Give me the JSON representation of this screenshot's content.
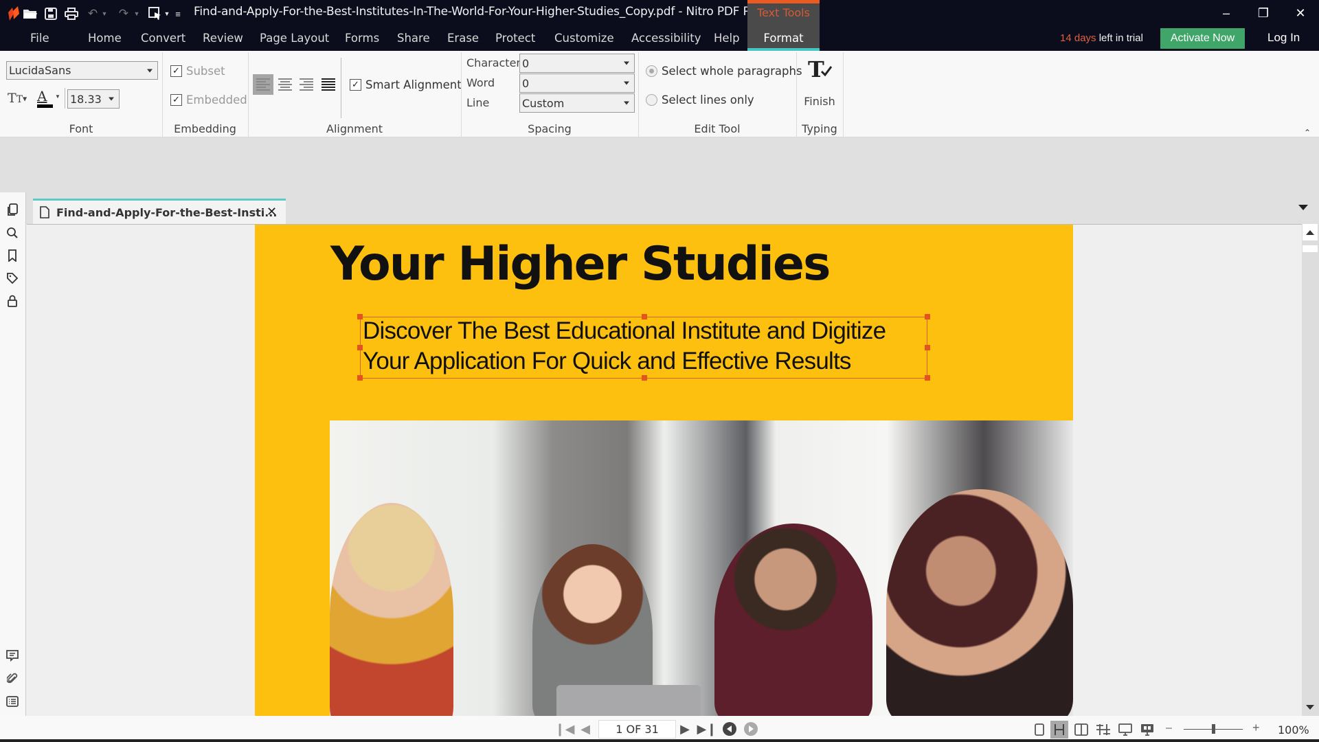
{
  "app": {
    "window_title": "Find-and-Apply-For-the-Best-Institutes-In-The-World-For-Your-Higher-Studies_Copy.pdf - Nitro PDF Pro",
    "quick_access": [
      "nitro-logo",
      "open-folder-icon",
      "save-icon",
      "print-icon",
      "undo-icon",
      "redo-icon",
      "select-icon",
      "customize-qat-icon"
    ],
    "contextual_tab_group": "Text Tools",
    "window_controls": {
      "minimize": "–",
      "restore": "❐",
      "close": "✕"
    }
  },
  "menu": {
    "items": [
      "File",
      "Home",
      "Convert",
      "Review",
      "Page Layout",
      "Forms",
      "Share",
      "Erase",
      "Protect",
      "Customize",
      "Accessibility",
      "Help"
    ],
    "active_tab": "Format"
  },
  "trial": {
    "days": "14 days",
    "suffix": " left in trial"
  },
  "activate_label": "Activate Now",
  "login_label": "Log In",
  "ribbon": {
    "font": {
      "label": "Font",
      "family": "LucidaSans",
      "size": "18.33"
    },
    "embedding": {
      "label": "Embedding",
      "subset": {
        "label": "Subset",
        "checked": true
      },
      "embedded": {
        "label": "Embedded",
        "checked": true
      }
    },
    "alignment": {
      "label": "Alignment",
      "active": "left",
      "smart_alignment": {
        "label": "Smart Alignment",
        "checked": true
      }
    },
    "spacing": {
      "label": "Spacing",
      "character": {
        "label": "Character",
        "value": "0"
      },
      "word": {
        "label": "Word",
        "value": "0"
      },
      "line": {
        "label": "Line",
        "value": "Custom"
      }
    },
    "edit_tool": {
      "label": "Edit Tool",
      "options": [
        "Select whole paragraphs",
        "Select lines only"
      ],
      "selected": "Select whole paragraphs"
    },
    "typing": {
      "label": "Typing",
      "finish_label": "Finish"
    }
  },
  "document_tab": {
    "title": "Find-and-Apply-For-the-Best-Insti..."
  },
  "document": {
    "heading": "Your Higher Studies",
    "selected_text": [
      "Discover The Best Educational Institute and Digitize",
      "Your Application For Quick and Effective Results"
    ],
    "photo_description": "four students collaborating around a laptop",
    "background_color": "#fdc00e"
  },
  "status": {
    "page_indicator": "1 OF 31",
    "zoom": "100%"
  },
  "colors": {
    "titlebar": "#0b0d1c",
    "accent_orange": "#ea5a21",
    "accent_teal": "#45c7c1",
    "activate_green": "#3fa568"
  }
}
